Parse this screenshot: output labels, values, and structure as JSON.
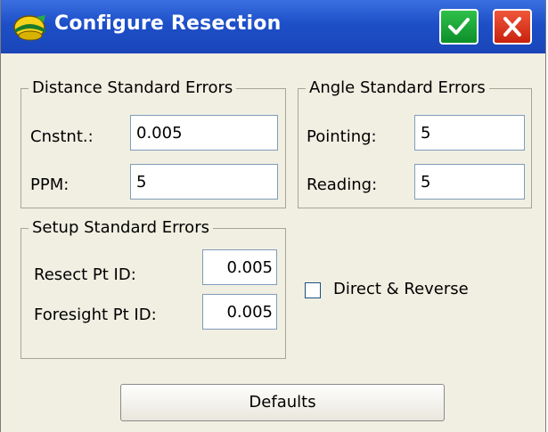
{
  "window": {
    "title": "Configure Resection"
  },
  "titlebar": {
    "app_icon": "surveyor-helmet-icon",
    "ok_icon": "checkmark-icon",
    "close_icon": "close-x-icon"
  },
  "distance_group": {
    "title": "Distance Standard Errors",
    "constant_label": "Cnstnt.:",
    "constant_value": "0.005",
    "ppm_label": "PPM:",
    "ppm_value": "5"
  },
  "angle_group": {
    "title": "Angle Standard Errors",
    "pointing_label": "Pointing:",
    "pointing_value": "5",
    "reading_label": "Reading:",
    "reading_value": "5"
  },
  "setup_group": {
    "title": "Setup Standard Errors",
    "resect_label": "Resect Pt ID:",
    "resect_value": "0.005",
    "foresight_label": "Foresight Pt ID:",
    "foresight_value": "0.005"
  },
  "direct_reverse": {
    "label": "Direct & Reverse",
    "checked": false
  },
  "defaults_button": {
    "label": "Defaults"
  },
  "colors": {
    "titlebar": "#1d4fc8",
    "ok": "#0d8f2a",
    "close": "#c8220e",
    "background": "#f1efe2"
  }
}
